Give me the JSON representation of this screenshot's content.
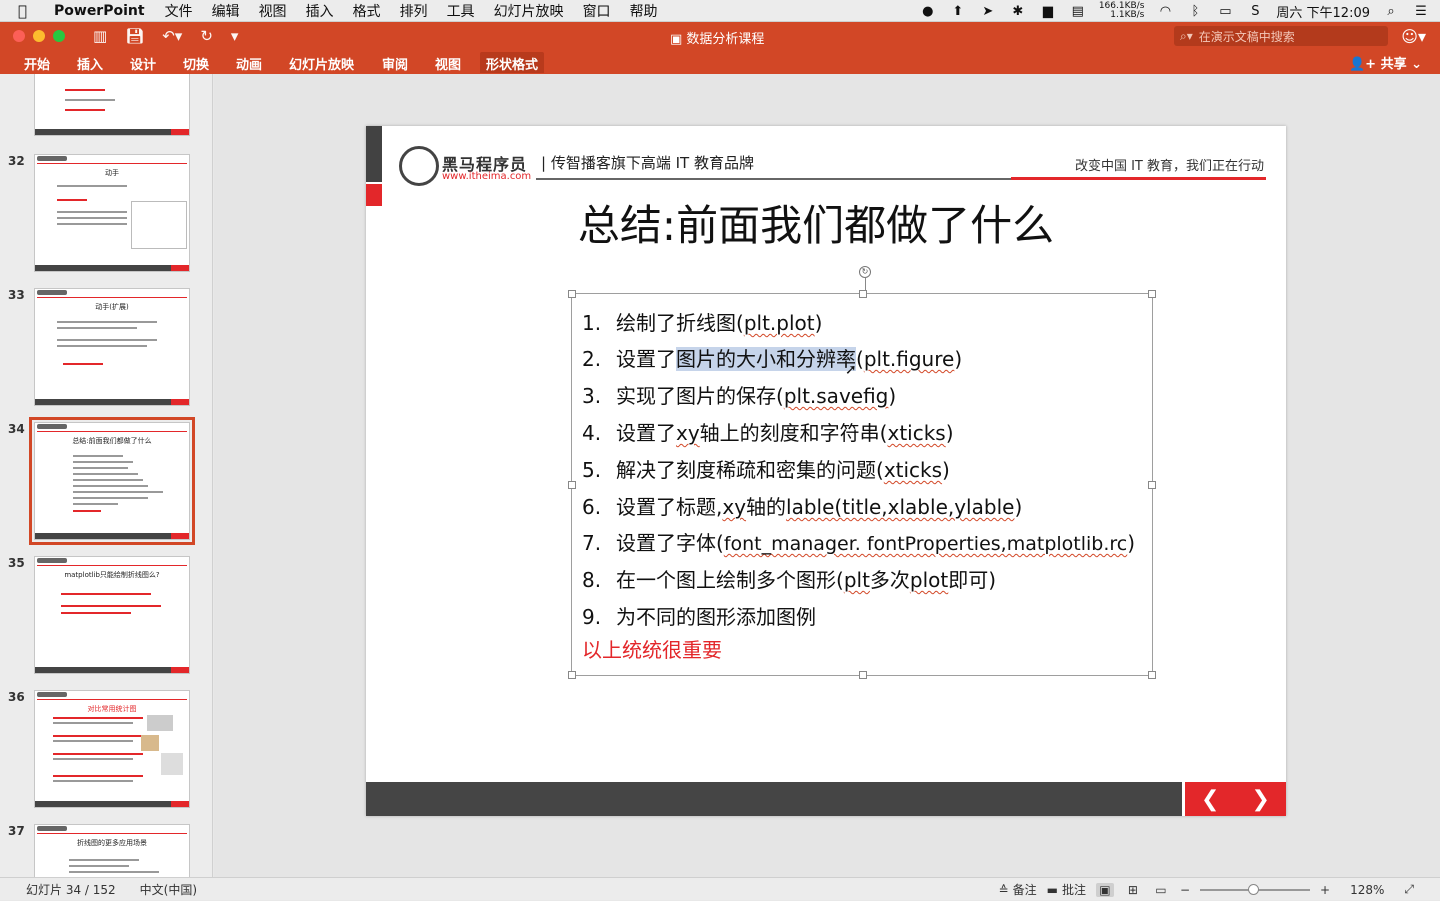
{
  "menubar": {
    "app_name": "PowerPoint",
    "items": [
      "文件",
      "编辑",
      "视图",
      "插入",
      "格式",
      "排列",
      "工具",
      "幻灯片放映",
      "窗口",
      "帮助"
    ],
    "net_up": "166.1KB/s",
    "net_down": "1.1KB/s",
    "clock": "周六 下午12:09"
  },
  "window": {
    "title": "数据分析课程",
    "search_placeholder": "在演示文稿中搜索",
    "share_label": "共享"
  },
  "ribbon": {
    "tabs": [
      "开始",
      "插入",
      "设计",
      "切换",
      "动画",
      "幻灯片放映",
      "审阅",
      "视图",
      "形状格式"
    ],
    "active_tab": "形状格式"
  },
  "thumbnails": [
    {
      "num": "32",
      "title": "动手"
    },
    {
      "num": "33",
      "title": "动手(扩展)"
    },
    {
      "num": "34",
      "title": "总结:前面我们都做了什么",
      "selected": true
    },
    {
      "num": "35",
      "title": "matplotlib只能绘制折线图么?"
    },
    {
      "num": "36",
      "title": "对比常用统计图"
    },
    {
      "num": "37",
      "title": "折线图的更多应用场景"
    }
  ],
  "slide": {
    "logo_name": "黑马程序员",
    "logo_url": "www.itheima.com",
    "brand_tagline": "| 传智播客旗下高端 IT 教育品牌",
    "slogan": "改变中国 IT 教育，我们正在行动",
    "title": "总结:前面我们都做了什么",
    "items": [
      {
        "num": "1.",
        "pre": "绘制了折线图(",
        "code": "plt.plot",
        "post": ")"
      },
      {
        "num": "2.",
        "pre": "设置了",
        "hl": "图片的大小和分辨率",
        "code_pre": "(",
        "code": "plt.figure",
        "post": ")"
      },
      {
        "num": "3.",
        "pre": "实现了图片的保存(",
        "code": "plt.savefig",
        "post": ")"
      },
      {
        "num": "4.",
        "pre": "设置了",
        "code": "xy",
        "mid": "轴上的刻度和字符串(",
        "code2": "xticks",
        "post": ")"
      },
      {
        "num": "5.",
        "pre": "解决了刻度稀疏和密集的问题(",
        "code": "xticks",
        "post": ")"
      },
      {
        "num": "6.",
        "pre": "设置了标题,",
        "code": "xy",
        "mid": "轴的",
        "code2": "lable(title,xlable,ylable",
        "post": ")"
      },
      {
        "num": "7.",
        "pre": "设置了字体(",
        "code": "font_manager. fontProperties,matplotlib.rc",
        "post": ")"
      },
      {
        "num": "8.",
        "pre": "在一个图上绘制多个图形(",
        "code": "plt",
        "mid": "多次",
        "code2": "plot",
        "post": "即可)"
      },
      {
        "num": "9.",
        "pre": "为不同的图形添加图例",
        "code": "",
        "post": ""
      }
    ],
    "conclusion": "以上统统很重要",
    "nav_prev": "❮",
    "nav_next": "❯"
  },
  "statusbar": {
    "slide_count": "幻灯片 34 / 152",
    "language": "中文(中国)",
    "notes_label": "备注",
    "comments_label": "批注",
    "zoom": "128%"
  }
}
